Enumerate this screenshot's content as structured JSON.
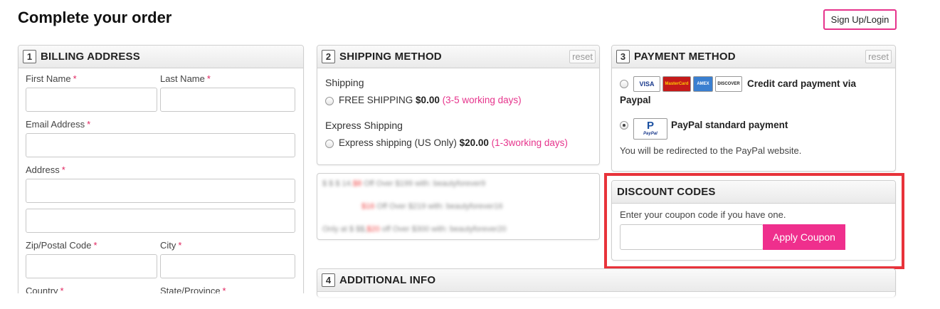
{
  "page": {
    "title": "Complete your order",
    "signup_label": "Sign Up/Login"
  },
  "billing": {
    "step": "1",
    "title": "BILLING ADDRESS",
    "required_mark": "*",
    "first_name_label": "First Name",
    "last_name_label": "Last Name",
    "email_label": "Email Address",
    "address_label": "Address",
    "zip_label": "Zip/Postal Code",
    "city_label": "City",
    "country_label": "Country",
    "state_label": "State/Province"
  },
  "shipping": {
    "step": "2",
    "title": "SHIPPING METHOD",
    "reset_label": "reset",
    "group1_heading": "Shipping",
    "group1_option": {
      "label": "FREE SHIPPING",
      "price": "$0.00",
      "days": "(3-5 working days)"
    },
    "group2_heading": "Express Shipping",
    "group2_option": {
      "label": "Express shipping (US Only)",
      "price": "$20.00",
      "days": "(1-3working days)"
    }
  },
  "payment": {
    "step": "3",
    "title": "PAYMENT METHOD",
    "reset_label": "reset",
    "card_logos": [
      "VISA",
      "MasterCard",
      "AMEX",
      "DISCOVER"
    ],
    "option1_label_line1": "Credit card payment via",
    "option1_label_line2": "Paypal",
    "option2_label": "PayPal standard payment",
    "paypal_logo": "PayPal",
    "redirect_note": "You will be redirected to the PayPal website."
  },
  "promo": {
    "line1": {
      "pre": "$ $ $ 14.",
      "red": "$8",
      "post": " Off Over $199 with: beautyforever9"
    },
    "line2": {
      "red": "$16",
      "post": " Off Over $219 with: beautyforever16"
    },
    "line3": {
      "pre": "Only at $ $$,",
      "red": "$20",
      "post": " off Over $300 with: beautyforever20"
    }
  },
  "discount": {
    "title": "DISCOUNT CODES",
    "hint": "Enter your coupon code if you have one.",
    "input_value": "",
    "apply_label": "Apply Coupon"
  },
  "additional": {
    "step": "4",
    "title": "ADDITIONAL INFO"
  },
  "colors": {
    "accent": "#ef2f8d",
    "highlight": "#e8333a"
  }
}
